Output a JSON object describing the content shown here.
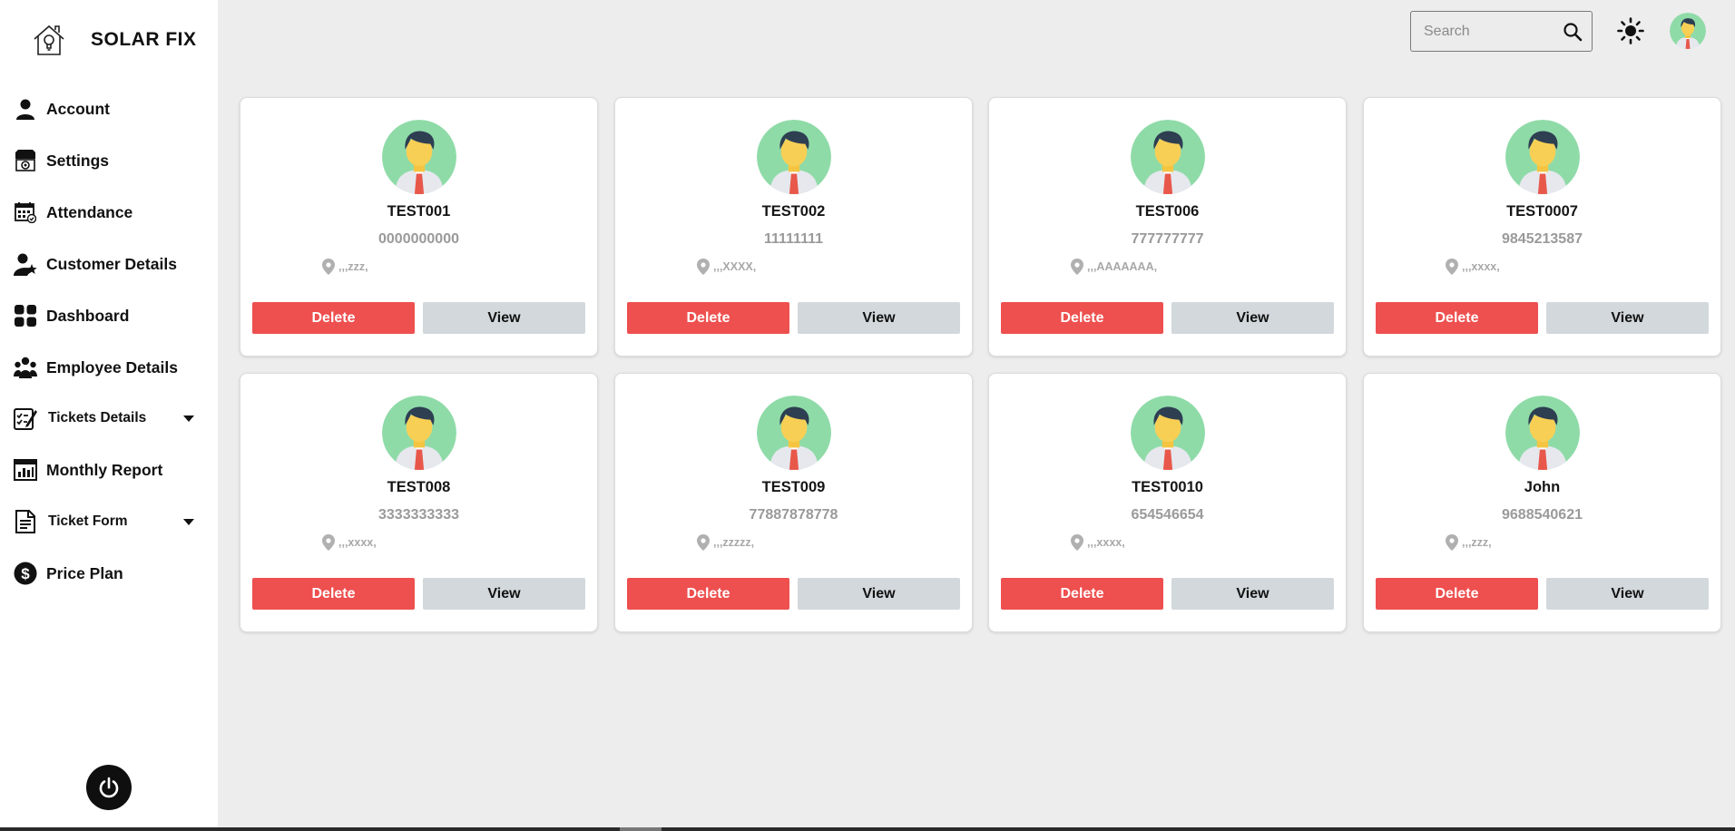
{
  "brand": {
    "name": "SOLAR FIX",
    "logo_icon": "house-bulb-icon"
  },
  "sidebar": {
    "items": [
      {
        "label": "Account",
        "icon": "user-icon"
      },
      {
        "label": "Settings",
        "icon": "settings-icon"
      },
      {
        "label": "Attendance",
        "icon": "calendar-icon"
      },
      {
        "label": "Customer Details",
        "icon": "user-star-icon"
      },
      {
        "label": "Dashboard",
        "icon": "grid-icon"
      },
      {
        "label": "Employee Details",
        "icon": "group-icon"
      },
      {
        "label": "Tickets Details",
        "icon": "checklist-icon",
        "dropdown": true
      },
      {
        "label": "Monthly Report",
        "icon": "report-icon"
      },
      {
        "label": "Ticket Form",
        "icon": "document-icon",
        "dropdown": true
      },
      {
        "label": "Price Plan",
        "icon": "dollar-icon"
      }
    ],
    "logout_icon": "power-icon"
  },
  "header": {
    "search_placeholder": "Search",
    "theme_icon": "sun-icon",
    "avatar_icon": "avatar-icon"
  },
  "colors": {
    "delete": "#ee4f4f",
    "view": "#d2d8dc",
    "background": "#ededed",
    "avatar_bg": "#8fdba8"
  },
  "employees": [
    {
      "name": "TEST001",
      "phone": "0000000000",
      "address": ",,,zzz,"
    },
    {
      "name": "TEST002",
      "phone": "11111111",
      "address": ",,,XXXX,"
    },
    {
      "name": "TEST006",
      "phone": "777777777",
      "address": ",,,AAAAAAA,"
    },
    {
      "name": "TEST0007",
      "phone": "9845213587",
      "address": ",,,xxxx,"
    },
    {
      "name": "TEST008",
      "phone": "3333333333",
      "address": ",,,xxxx,"
    },
    {
      "name": "TEST009",
      "phone": "77887878778",
      "address": ",,,zzzzz,"
    },
    {
      "name": "TEST0010",
      "phone": "654546654",
      "address": ",,,xxxx,"
    },
    {
      "name": "John",
      "phone": "9688540621",
      "address": ",,,zzz,"
    }
  ],
  "card_actions": {
    "delete_label": "Delete",
    "view_label": "View"
  }
}
